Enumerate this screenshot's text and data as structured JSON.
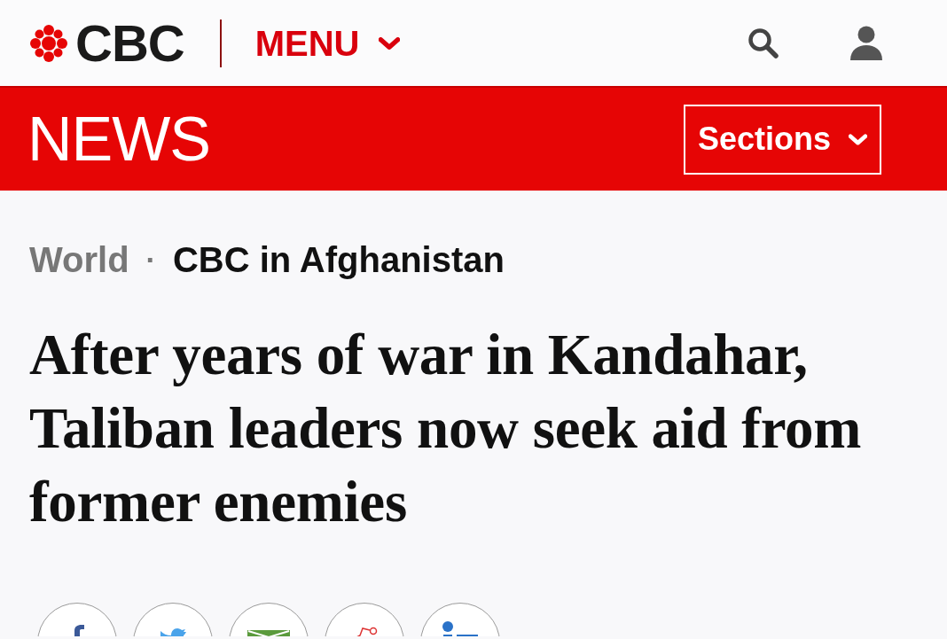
{
  "header": {
    "logo_text": "CBC",
    "menu_label": "MENU"
  },
  "news_bar": {
    "title": "NEWS",
    "sections_label": "Sections"
  },
  "breadcrumb": {
    "items": [
      {
        "label": "World",
        "kind": "section"
      },
      {
        "label": "CBC in Afghanistan",
        "kind": "topic"
      }
    ],
    "separator": "·"
  },
  "headline": "After years of war in Kandahar, Taliban leaders now seek aid from former enemies",
  "share_buttons": [
    {
      "kind": "facebook"
    },
    {
      "kind": "twitter"
    },
    {
      "kind": "email"
    },
    {
      "kind": "reddit"
    },
    {
      "kind": "linkedin"
    }
  ]
}
